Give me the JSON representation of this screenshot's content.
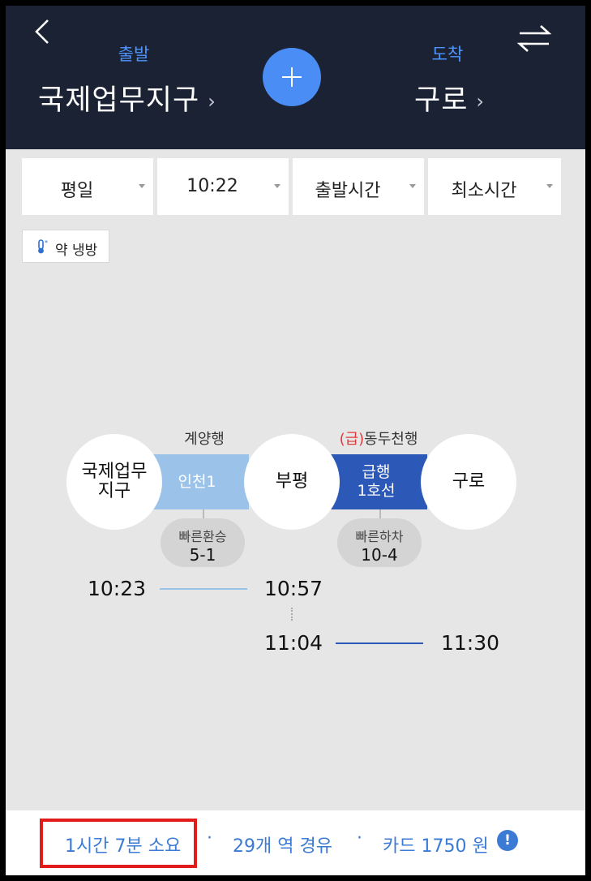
{
  "header": {
    "departure_label": "출발",
    "departure_station": "국제업무지구",
    "arrival_label": "도착",
    "arrival_station": "구로",
    "chevron": "›"
  },
  "filters": [
    {
      "label": "평일"
    },
    {
      "label": "10:22"
    },
    {
      "label": "출발시간"
    },
    {
      "label": "최소시간"
    }
  ],
  "aircon": {
    "label": "약 냉방"
  },
  "route": {
    "segments": [
      {
        "direction": "계양행",
        "line_label": "인천1",
        "color": "#9bc3ea"
      },
      {
        "direction_prefix": "(급)",
        "direction": "동두천행",
        "line_label_1": "급행",
        "line_label_2": "1호선",
        "color": "#2c58b8"
      }
    ],
    "stations": [
      {
        "name_1": "국제업무",
        "name_2": "지구"
      },
      {
        "name": "부평"
      },
      {
        "name": "구로"
      }
    ],
    "transfers": [
      {
        "label": "빠른환승",
        "value": "5-1"
      },
      {
        "label": "빠른하차",
        "value": "10-4"
      }
    ],
    "times": {
      "leg1_depart": "10:23",
      "leg1_arrive": "10:57",
      "leg2_depart": "11:04",
      "leg2_arrive": "11:30"
    }
  },
  "summary": {
    "duration": "1시간 7분 소요",
    "separator": "·",
    "stations": "29개 역 경유",
    "fare": "카드 1750 원",
    "info_icon": "!"
  },
  "colors": {
    "header_bg": "#1a2233",
    "accent_blue": "#4a8ef5",
    "line_incheon1": "#9bc3ea",
    "line_1": "#2c58b8",
    "highlight": "#e21b1b"
  }
}
